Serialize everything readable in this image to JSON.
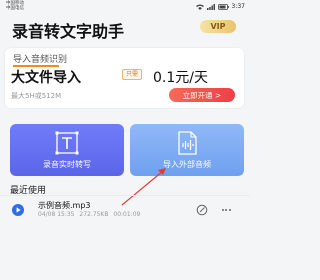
{
  "status_bar": {
    "carrier_line1": "中国移动",
    "carrier_line2": "中国电信",
    "time": "3:37"
  },
  "app": {
    "title": "录音转文字助手",
    "vip_label": "VIP"
  },
  "promo": {
    "tab_label": "导入音频识别",
    "headline": "大文件导入",
    "tag": "只需",
    "price": "0.1元/天",
    "subtitle": "最大5H或512M",
    "cta": "立即开通 >"
  },
  "actions": [
    {
      "label": "录音实时转写",
      "icon": "text-frame-icon"
    },
    {
      "label": "导入外部音频",
      "icon": "audio-file-icon"
    }
  ],
  "recent": {
    "title": "最近使用",
    "items": [
      {
        "name": "示例音频.mp3",
        "date": "04/08 15:35",
        "size": "272.75KB",
        "duration": "00:01:09"
      }
    ]
  },
  "colors": {
    "record_card": "#5a66e8",
    "import_card": "#6fa0ef",
    "promo_button": "#ee3f47",
    "accent_orange": "#f28a1e",
    "annotation_arrow": "#e53935"
  }
}
